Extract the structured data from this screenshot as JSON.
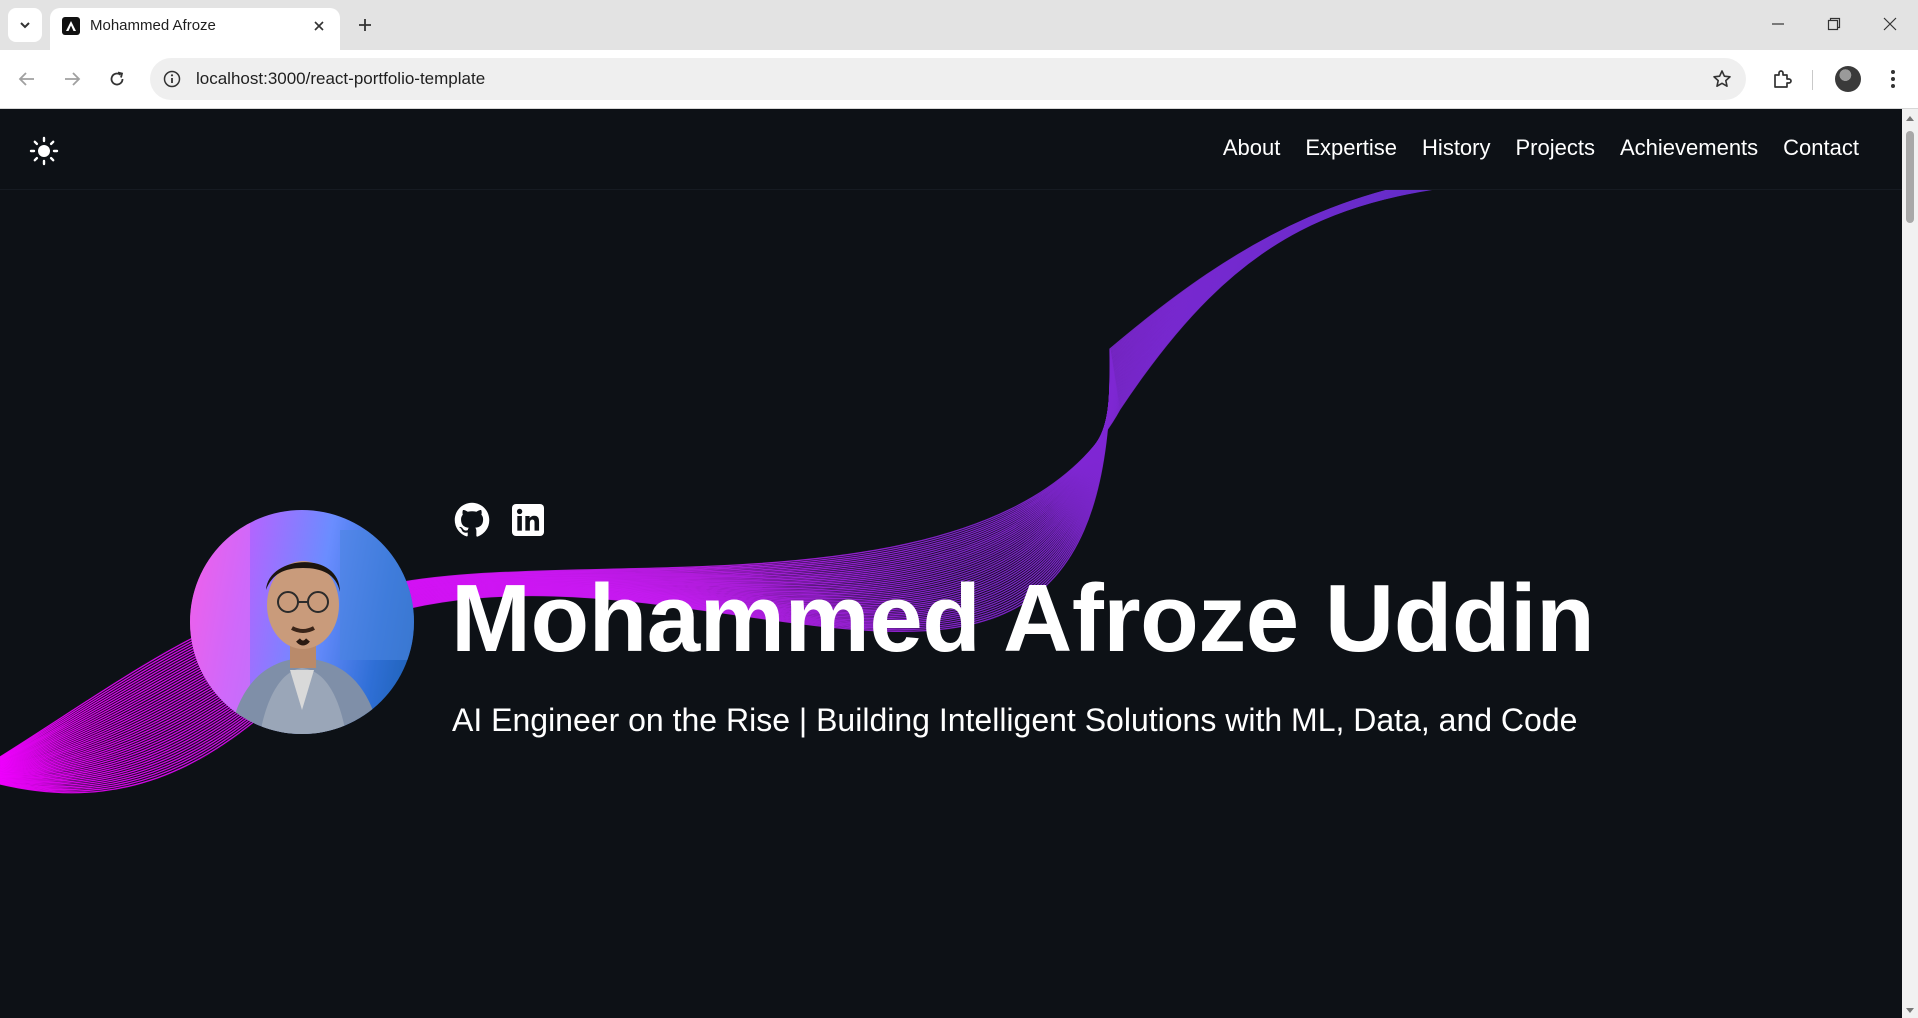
{
  "browser": {
    "tab_title": "Mohammed Afroze",
    "url": "localhost:3000/react-portfolio-template"
  },
  "nav": {
    "links": [
      "About",
      "Expertise",
      "History",
      "Projects",
      "Achievements",
      "Contact"
    ]
  },
  "hero": {
    "name": "Mohammed Afroze Uddin",
    "subtitle": "AI Engineer on the Rise | Building Intelligent Solutions with ML, Data, and Code",
    "socials": [
      "github-icon",
      "linkedin-icon"
    ]
  },
  "colors": {
    "page_background": "#0d1116",
    "wave_magenta": "#e600ff",
    "wave_purple": "#7a2bd6",
    "wave_indigo": "#5b2fc2"
  }
}
